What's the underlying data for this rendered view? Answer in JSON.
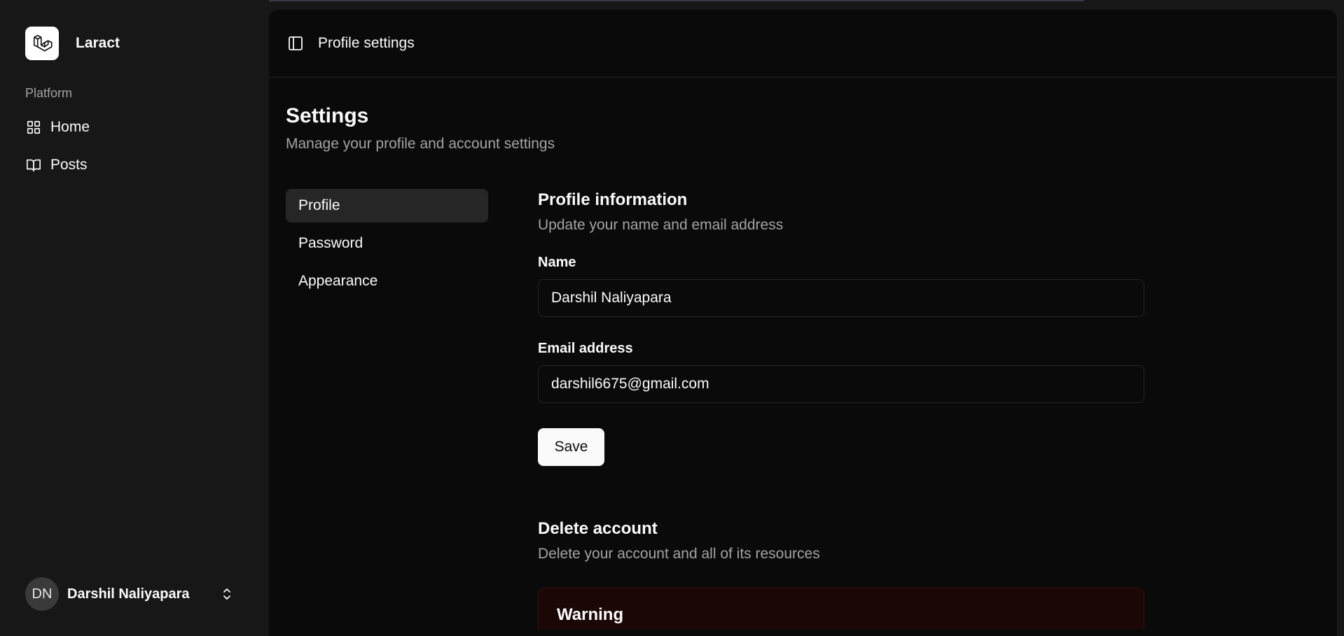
{
  "app": {
    "name": "Laract"
  },
  "sidebar": {
    "group_label": "Platform",
    "items": [
      {
        "label": "Home",
        "icon": "layout-grid-icon"
      },
      {
        "label": "Posts",
        "icon": "book-open-icon"
      }
    ],
    "user": {
      "initials": "DN",
      "name": "Darshil Naliyapara"
    }
  },
  "header": {
    "title": "Profile settings"
  },
  "settings": {
    "title": "Settings",
    "subtitle": "Manage your profile and account settings",
    "tabs": [
      {
        "label": "Profile",
        "active": true
      },
      {
        "label": "Password",
        "active": false
      },
      {
        "label": "Appearance",
        "active": false
      }
    ]
  },
  "profile": {
    "title": "Profile information",
    "subtitle": "Update your name and email address",
    "name_label": "Name",
    "name_value": "Darshil Naliyapara",
    "email_label": "Email address",
    "email_value": "darshil6675@gmail.com",
    "save_label": "Save"
  },
  "delete_account": {
    "title": "Delete account",
    "subtitle": "Delete your account and all of its resources",
    "warning_title": "Warning"
  },
  "colors": {
    "sidebar_bg": "#171717",
    "main_bg": "#0a0a0a",
    "active_tab_bg": "#262626",
    "warning_bg": "#1c0707"
  }
}
